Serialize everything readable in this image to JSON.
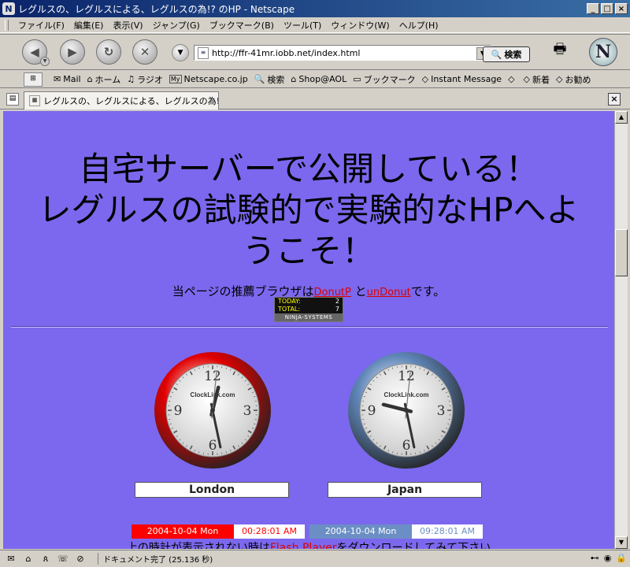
{
  "window": {
    "title": "レグルスの、レグルスによる、レグルスの為!? のHP - Netscape",
    "app_icon": "N"
  },
  "menu": [
    "ファイル(F)",
    "編集(E)",
    "表示(V)",
    "ジャンプ(G)",
    "ブックマーク(B)",
    "ツール(T)",
    "ウィンドウ(W)",
    "ヘルプ(H)"
  ],
  "nav": {
    "url": "http://ffr-41mr.iobb.net/index.html",
    "search_label": "検索"
  },
  "bookmarks": [
    {
      "icon": "mail-icon",
      "label": "Mail"
    },
    {
      "icon": "home-icon",
      "label": "ホーム"
    },
    {
      "icon": "radio-icon",
      "label": "ラジオ"
    },
    {
      "icon": "my-icon",
      "label": "Netscape.co.jp"
    },
    {
      "icon": "search-icon",
      "label": "検索"
    },
    {
      "icon": "aol-icon",
      "label": "Shop@AOL"
    },
    {
      "icon": "folder-icon",
      "label": "ブックマーク"
    },
    {
      "icon": "im-icon",
      "label": "Instant Message"
    },
    {
      "icon": "bookmark-icon",
      "label": ""
    },
    {
      "icon": "bookmark-icon",
      "label": "新着"
    },
    {
      "icon": "bookmark-icon",
      "label": "お勧め"
    }
  ],
  "tab": {
    "title": "レグルスの、レグルスによる、レグルスの為!? の..."
  },
  "page": {
    "heading_line1": "自宅サーバーで公開している！",
    "heading_line2": "レグルスの試験的で実験的なHPへよ",
    "heading_line3": "うこそ！",
    "browser_note_prefix": "当ページの推薦ブラウザは",
    "link1": "DonutP",
    "browser_note_mid": " と",
    "link2": "unDonut",
    "browser_note_suffix": "です。",
    "counter": {
      "today_label": "TODAY:",
      "today_value": "2",
      "total_label": "TOTAL:",
      "total_value": "7",
      "footer": "NINJA-SYSTEMS"
    },
    "clocks": [
      {
        "city": "London",
        "brand": "ClockLink.com",
        "date": "2004-10-04  Mon",
        "time": "00:28:01  AM",
        "hour": 0,
        "minute": 28,
        "second": 1,
        "ring_color": "#e00000",
        "date_bg": "#ff0000",
        "date_fg": "#ffffff",
        "time_fg": "#ff0000"
      },
      {
        "city": "Japan",
        "brand": "ClockLink.com",
        "date": "2004-10-04  Mon",
        "time": "09:28:01  AM",
        "hour": 9,
        "minute": 28,
        "second": 1,
        "ring_color": "#5f86b8",
        "date_bg": "#6b8fc4",
        "date_fg": "#ffffff",
        "time_fg": "#6b8fc4"
      }
    ],
    "footnote_prefix": "上の時計が表示されない時は",
    "footnote_link": "Flash Player",
    "footnote_suffix": "をダウンロードしてみて下さい"
  },
  "status": {
    "text": "ドキュメント完了 (25.136 秒)"
  },
  "colors": {
    "page_bg": "#7b68ee",
    "link": "#dd0000"
  }
}
